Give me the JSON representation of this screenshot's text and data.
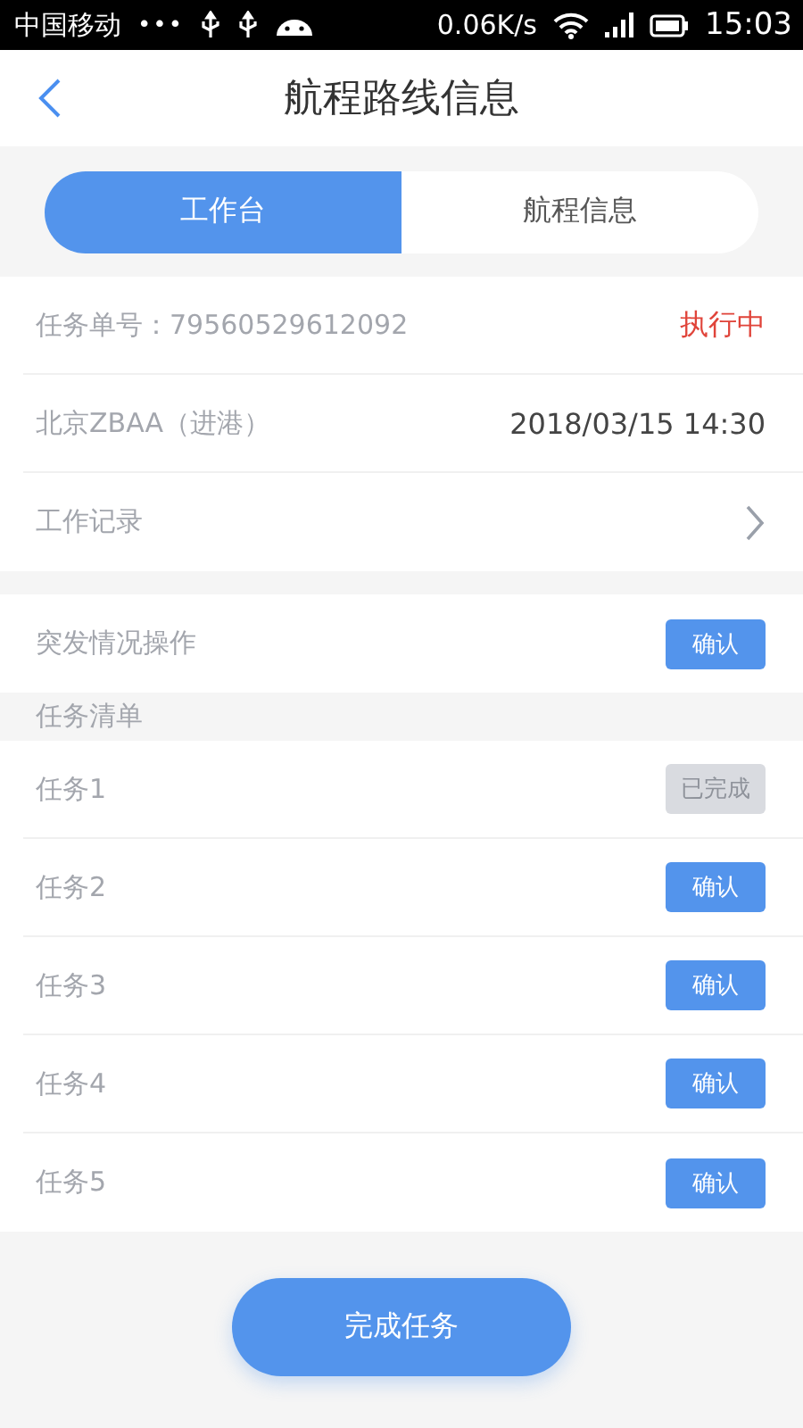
{
  "status_bar": {
    "carrier": "中国移动",
    "dots": "•••",
    "speed": "0.06K/s",
    "time": "15:03"
  },
  "header": {
    "title": "航程路线信息"
  },
  "tabs": [
    {
      "label": "工作台",
      "selected": true
    },
    {
      "label": "航程信息",
      "selected": false
    }
  ],
  "info": {
    "order_label": "任务单号：79560529612092",
    "order_status": "执行中",
    "airport": "北京ZBAA（进港）",
    "datetime": "2018/03/15 14:30",
    "work_log": "工作记录"
  },
  "emergency": {
    "label": "突发情况操作",
    "button": "确认"
  },
  "task_section": {
    "title": "任务清单"
  },
  "tasks": [
    {
      "name": "任务1",
      "button": "已完成",
      "done": true
    },
    {
      "name": "任务2",
      "button": "确认",
      "done": false
    },
    {
      "name": "任务3",
      "button": "确认",
      "done": false
    },
    {
      "name": "任务4",
      "button": "确认",
      "done": false
    },
    {
      "name": "任务5",
      "button": "确认",
      "done": false
    }
  ],
  "footer": {
    "button": "完成任务"
  }
}
